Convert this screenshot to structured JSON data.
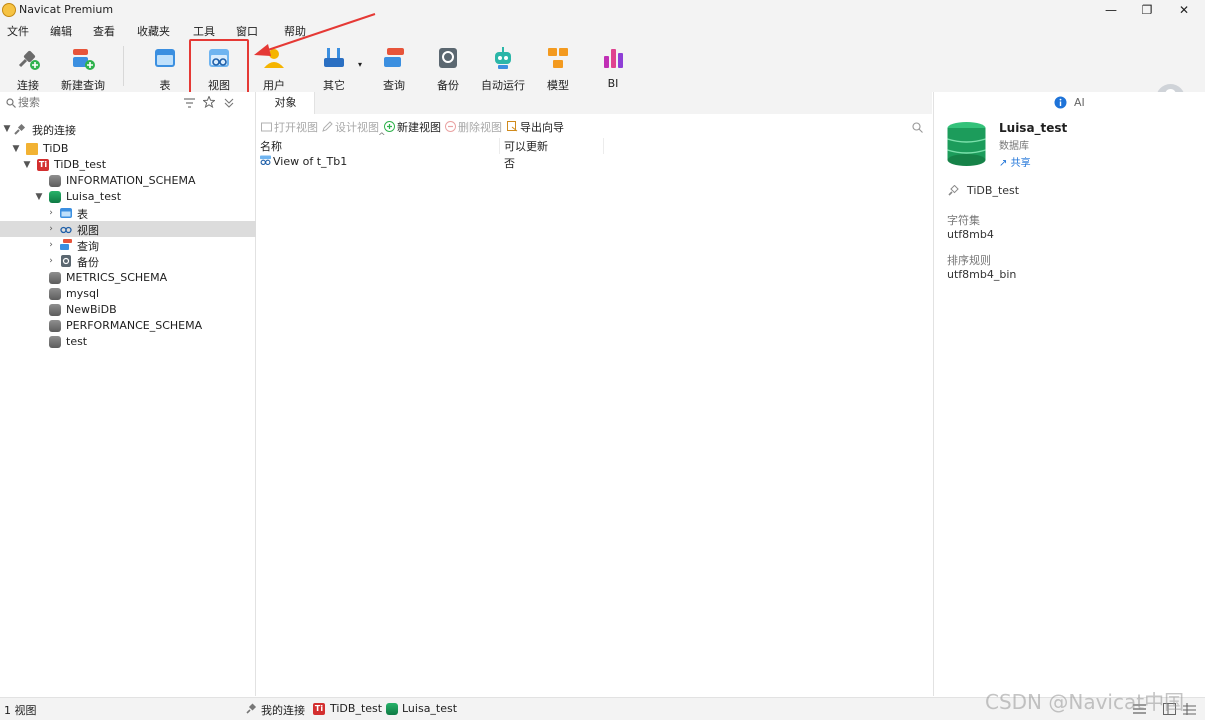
{
  "window": {
    "title": "Navicat Premium",
    "minimize": "—",
    "maximize": "❐",
    "close": "✕"
  },
  "menu": [
    "文件",
    "编辑",
    "查看",
    "收藏夹",
    "工具",
    "窗口",
    "帮助"
  ],
  "toolbar": {
    "connect": "连接",
    "new_query": "新建查询",
    "table": "表",
    "view": "视图",
    "user": "用户",
    "other": "其它",
    "query": "查询",
    "backup": "备份",
    "automation": "自动运行",
    "model": "模型",
    "bi": "BI"
  },
  "left": {
    "search_placeholder": "搜索",
    "tree": {
      "root": "我的连接",
      "group": "TiDB",
      "connection": "TiDB_test",
      "databases": [
        "INFORMATION_SCHEMA",
        "Luisa_test",
        "METRICS_SCHEMA",
        "mysql",
        "NewBiDB",
        "PERFORMANCE_SCHEMA",
        "test"
      ],
      "luisa_children": [
        "表",
        "视图",
        "查询",
        "备份"
      ]
    }
  },
  "center": {
    "tab": "对象",
    "actions": {
      "open": "打开视图",
      "design": "设计视图",
      "new": "新建视图",
      "delete": "删除视图",
      "export": "导出向导"
    },
    "columns": [
      "名称",
      "可以更新"
    ],
    "rows": [
      {
        "name": "View of t_Tb1",
        "updatable": "否"
      }
    ]
  },
  "right": {
    "ai_label": "AI",
    "db_name": "Luisa_test",
    "db_type": "数据库",
    "share": "共享",
    "connection": "TiDB_test",
    "charset_label": "字符集",
    "charset": "utf8mb4",
    "collation_label": "排序规则",
    "collation": "utf8mb4_bin"
  },
  "status": {
    "count": "1 视图",
    "crumb_root": "我的连接",
    "crumb_conn": "TiDB_test",
    "crumb_db": "Luisa_test"
  },
  "watermark": "CSDN @Navicat中国"
}
